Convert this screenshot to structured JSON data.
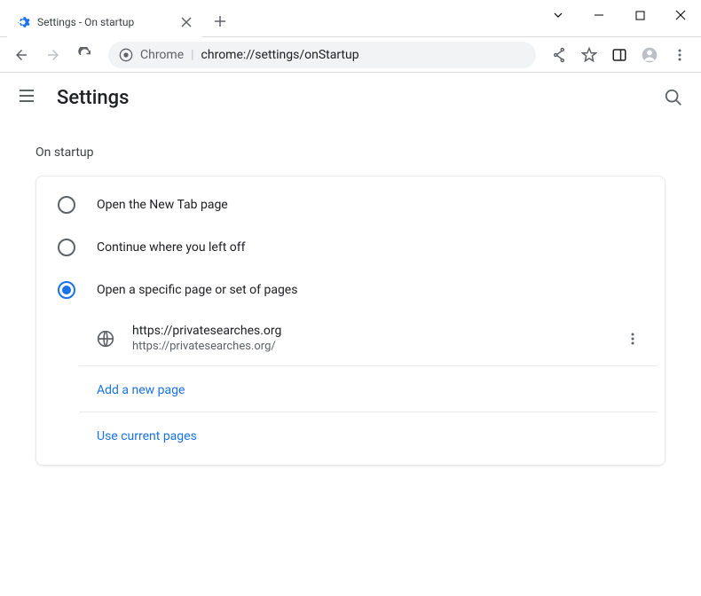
{
  "window": {
    "tab_title": "Settings - On startup"
  },
  "omnibox": {
    "prefix": "Chrome",
    "path": "chrome://settings/onStartup"
  },
  "header": {
    "title": "Settings"
  },
  "section": {
    "title": "On startup",
    "options": [
      {
        "label": "Open the New Tab page",
        "selected": false
      },
      {
        "label": "Continue where you left off",
        "selected": false
      },
      {
        "label": "Open a specific page or set of pages",
        "selected": true
      }
    ],
    "pages": [
      {
        "title": "https://privatesearches.org",
        "url": "https://privatesearches.org/"
      }
    ],
    "add_label": "Add a new page",
    "use_current_label": "Use current pages"
  }
}
